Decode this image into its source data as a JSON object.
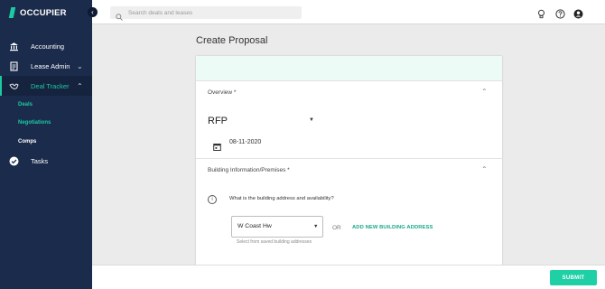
{
  "app": {
    "logo_text": "OCCUPIER",
    "accent": "#1cc9a3",
    "sidebar_bg": "#1b2b4b"
  },
  "sidebar": {
    "items": [
      {
        "label": "Accounting",
        "icon": "bank-icon"
      },
      {
        "label": "Lease Admin",
        "icon": "document-icon"
      },
      {
        "label": "Deal Tracker",
        "icon": "handshake-icon"
      },
      {
        "label": "Tasks",
        "icon": "check-circle-icon"
      }
    ],
    "sub_items": [
      {
        "label": "Deals"
      },
      {
        "label": "Negotiations"
      },
      {
        "label": "Comps"
      }
    ]
  },
  "search": {
    "placeholder": "Search deals and leases"
  },
  "page": {
    "title": "Create Proposal"
  },
  "form": {
    "overview_title": "Overview *",
    "type_value": "RFP",
    "date_value": "08-11-2020",
    "building_title": "Building Information/Premises *",
    "question": "What is the building address and availability?",
    "address_value": "W Coast Hw",
    "address_hint": "Select from saved building addresses",
    "or_text": "OR",
    "add_link": "ADD NEW BUILDING ADDRESS"
  },
  "footer": {
    "submit_label": "SUBMIT"
  }
}
